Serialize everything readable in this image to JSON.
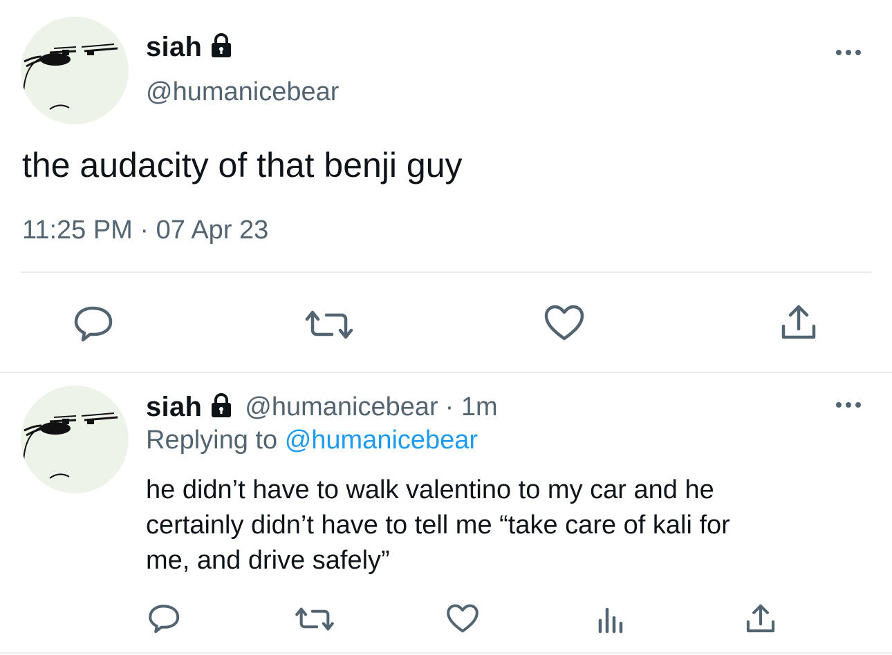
{
  "main_tweet": {
    "display_name": "siah",
    "handle": "@humanicebear",
    "text": "the audacity of that benji guy",
    "timestamp": "11:25 PM · 07 Apr 23"
  },
  "reply_tweet": {
    "display_name": "siah",
    "handle": "@humanicebear",
    "time_ago": "· 1m",
    "replying_prefix": "Replying to",
    "replying_to": "@humanicebear",
    "text_lines": [
      "he didn’t have to walk valentino to my car and he",
      "certainly didn’t have to tell me “take care of kali for",
      "me, and drive safely”"
    ]
  },
  "icons": {
    "more": "more-horizontal-icon",
    "reply": "reply-icon",
    "retweet": "retweet-icon",
    "like": "heart-icon",
    "views": "views-icon",
    "share": "share-icon",
    "lock": "lock-icon"
  },
  "colors": {
    "text": "#0f1419",
    "secondary": "#536471",
    "link": "#1d9bf0",
    "divider": "#e7e9ea"
  }
}
